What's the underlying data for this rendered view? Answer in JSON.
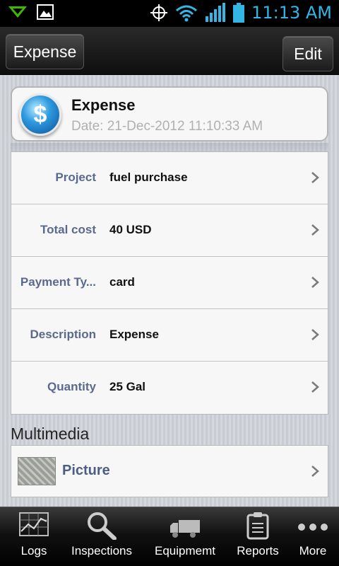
{
  "status_bar": {
    "time": "11:13 AM"
  },
  "action_bar": {
    "back_label": "Expense",
    "edit_label": "Edit"
  },
  "header": {
    "title": "Expense",
    "date": "Date: 21-Dec-2012 11:10:33 AM",
    "icon": "dollar-icon"
  },
  "fields": [
    {
      "label": "Project",
      "value": "fuel purchase"
    },
    {
      "label": "Total cost",
      "value": "40 USD"
    },
    {
      "label": "Payment Ty...",
      "value": "card"
    },
    {
      "label": "Description",
      "value": "Expense"
    },
    {
      "label": "Quantity",
      "value": "25 Gal"
    }
  ],
  "multimedia": {
    "title": "Multimedia",
    "items": [
      {
        "label": "Picture"
      }
    ]
  },
  "tabs": [
    {
      "label": "Logs",
      "icon": "logs-chart-icon"
    },
    {
      "label": "Inspections",
      "icon": "magnifier-icon"
    },
    {
      "label": "Equipmemt",
      "icon": "truck-icon"
    },
    {
      "label": "Reports",
      "icon": "clipboard-icon"
    },
    {
      "label": "More",
      "icon": "more-dots-icon"
    }
  ],
  "colors": {
    "accent": "#33b5e5",
    "label_blue": "#5a6a8e"
  }
}
